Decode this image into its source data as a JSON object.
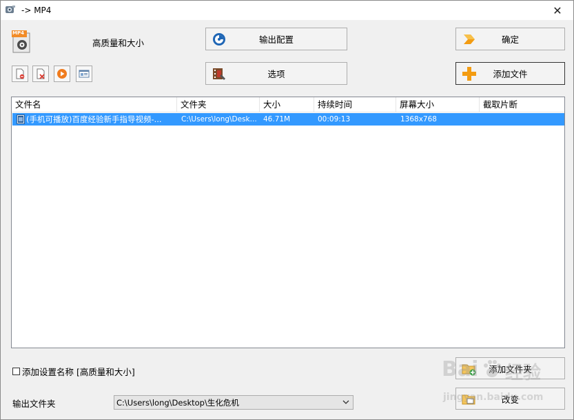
{
  "window": {
    "title": "-> MP4",
    "close_glyph": "✕"
  },
  "profile": {
    "format_badge": "MP4",
    "label": "高质量和大小"
  },
  "buttons": {
    "output_config": "输出配置",
    "ok": "确定",
    "options": "选项",
    "add_file": "添加文件",
    "add_folder": "添加文件夹",
    "change": "改变"
  },
  "toolbar": {
    "icons": [
      "remove-file-icon",
      "delete-file-icon",
      "play-icon",
      "media-info-icon"
    ]
  },
  "file_list": {
    "columns": [
      "文件名",
      "文件夹",
      "大小",
      "持续时间",
      "屏幕大小",
      "截取片断"
    ],
    "rows": [
      {
        "name": "(手机可播放)百度经验新手指导视频-...",
        "folder": "C:\\Users\\long\\Desk...",
        "size": "46.71M",
        "duration": "00:09:13",
        "screen_size": "1368x768",
        "clip": ""
      }
    ],
    "selection_color": "#3399ff"
  },
  "settings": {
    "add_name_label": "添加设置名称 [高质量和大小]",
    "add_name_checked": false
  },
  "output": {
    "label": "输出文件夹",
    "folder": "C:\\Users\\long\\Desktop\\生化危机"
  },
  "watermark": {
    "brand": "Bai",
    "brand_suffix": "经验",
    "url": "jingyan.baidu.com"
  }
}
